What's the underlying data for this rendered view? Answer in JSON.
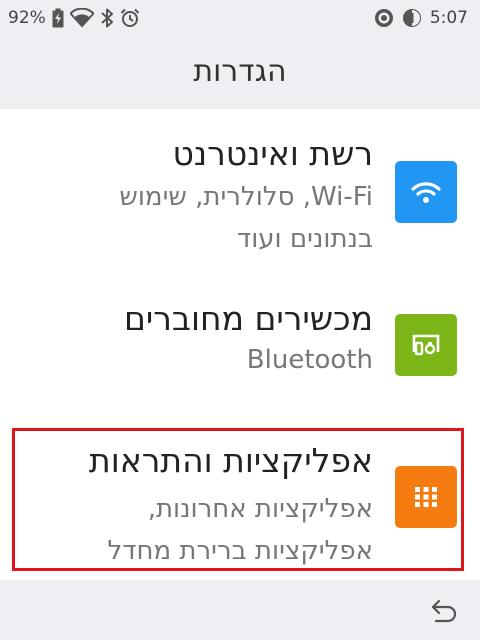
{
  "status_bar": {
    "battery_percent": "92%",
    "time": "5:07",
    "icons": [
      "battery-charging-icon",
      "wifi-icon",
      "bluetooth-icon",
      "alarm-icon",
      "vpn-icon",
      "data-saver-icon"
    ]
  },
  "header": {
    "title": "הגדרות"
  },
  "settings": {
    "items": [
      {
        "title": "רשת ואינטרנט",
        "subtitle_line1": "Wi-Fi, סלולרית, שימוש",
        "subtitle_line2": "בנתונים ועוד",
        "icon": "wifi-icon",
        "icon_color": "#2196f3"
      },
      {
        "title": "מכשירים מחוברים",
        "subtitle_line1": "Bluetooth",
        "icon": "connected-devices-icon",
        "icon_color": "#7cb518"
      },
      {
        "title": "אפליקציות והתראות",
        "subtitle_line1": "אפליקציות אחרונות,",
        "subtitle_line2": "אפליקציות ברירת מחדל",
        "icon": "apps-grid-icon",
        "icon_color": "#f57c10",
        "highlighted": true
      }
    ]
  },
  "colors": {
    "bars_background": "#eeeef3",
    "highlight": "#e0141b"
  },
  "nav_bar": {
    "back_icon": "back-arrow-icon"
  }
}
